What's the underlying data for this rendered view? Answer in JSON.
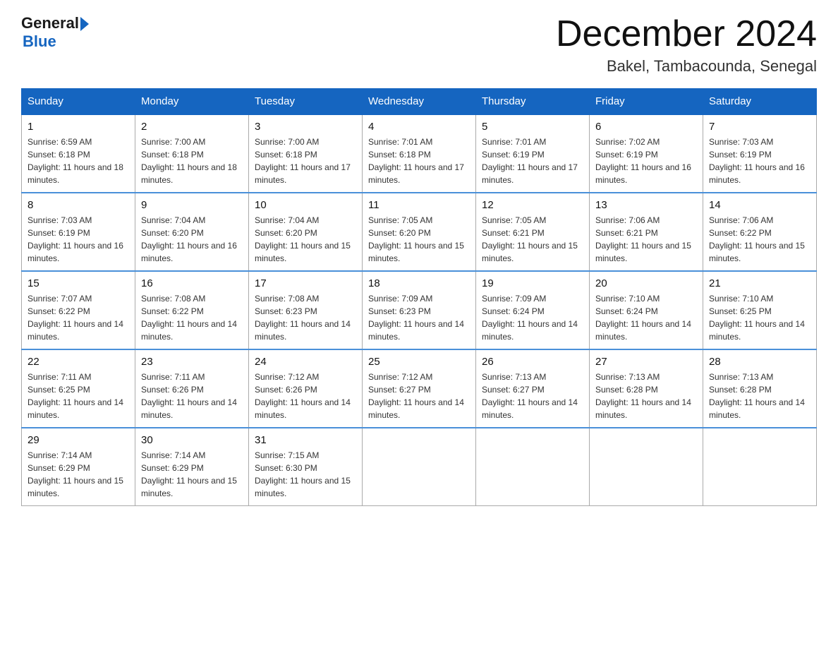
{
  "header": {
    "logo_general": "General",
    "logo_blue": "Blue",
    "title": "December 2024",
    "subtitle": "Bakel, Tambacounda, Senegal"
  },
  "days_of_week": [
    "Sunday",
    "Monday",
    "Tuesday",
    "Wednesday",
    "Thursday",
    "Friday",
    "Saturday"
  ],
  "weeks": [
    [
      {
        "day": "1",
        "sunrise": "Sunrise: 6:59 AM",
        "sunset": "Sunset: 6:18 PM",
        "daylight": "Daylight: 11 hours and 18 minutes."
      },
      {
        "day": "2",
        "sunrise": "Sunrise: 7:00 AM",
        "sunset": "Sunset: 6:18 PM",
        "daylight": "Daylight: 11 hours and 18 minutes."
      },
      {
        "day": "3",
        "sunrise": "Sunrise: 7:00 AM",
        "sunset": "Sunset: 6:18 PM",
        "daylight": "Daylight: 11 hours and 17 minutes."
      },
      {
        "day": "4",
        "sunrise": "Sunrise: 7:01 AM",
        "sunset": "Sunset: 6:18 PM",
        "daylight": "Daylight: 11 hours and 17 minutes."
      },
      {
        "day": "5",
        "sunrise": "Sunrise: 7:01 AM",
        "sunset": "Sunset: 6:19 PM",
        "daylight": "Daylight: 11 hours and 17 minutes."
      },
      {
        "day": "6",
        "sunrise": "Sunrise: 7:02 AM",
        "sunset": "Sunset: 6:19 PM",
        "daylight": "Daylight: 11 hours and 16 minutes."
      },
      {
        "day": "7",
        "sunrise": "Sunrise: 7:03 AM",
        "sunset": "Sunset: 6:19 PM",
        "daylight": "Daylight: 11 hours and 16 minutes."
      }
    ],
    [
      {
        "day": "8",
        "sunrise": "Sunrise: 7:03 AM",
        "sunset": "Sunset: 6:19 PM",
        "daylight": "Daylight: 11 hours and 16 minutes."
      },
      {
        "day": "9",
        "sunrise": "Sunrise: 7:04 AM",
        "sunset": "Sunset: 6:20 PM",
        "daylight": "Daylight: 11 hours and 16 minutes."
      },
      {
        "day": "10",
        "sunrise": "Sunrise: 7:04 AM",
        "sunset": "Sunset: 6:20 PM",
        "daylight": "Daylight: 11 hours and 15 minutes."
      },
      {
        "day": "11",
        "sunrise": "Sunrise: 7:05 AM",
        "sunset": "Sunset: 6:20 PM",
        "daylight": "Daylight: 11 hours and 15 minutes."
      },
      {
        "day": "12",
        "sunrise": "Sunrise: 7:05 AM",
        "sunset": "Sunset: 6:21 PM",
        "daylight": "Daylight: 11 hours and 15 minutes."
      },
      {
        "day": "13",
        "sunrise": "Sunrise: 7:06 AM",
        "sunset": "Sunset: 6:21 PM",
        "daylight": "Daylight: 11 hours and 15 minutes."
      },
      {
        "day": "14",
        "sunrise": "Sunrise: 7:06 AM",
        "sunset": "Sunset: 6:22 PM",
        "daylight": "Daylight: 11 hours and 15 minutes."
      }
    ],
    [
      {
        "day": "15",
        "sunrise": "Sunrise: 7:07 AM",
        "sunset": "Sunset: 6:22 PM",
        "daylight": "Daylight: 11 hours and 14 minutes."
      },
      {
        "day": "16",
        "sunrise": "Sunrise: 7:08 AM",
        "sunset": "Sunset: 6:22 PM",
        "daylight": "Daylight: 11 hours and 14 minutes."
      },
      {
        "day": "17",
        "sunrise": "Sunrise: 7:08 AM",
        "sunset": "Sunset: 6:23 PM",
        "daylight": "Daylight: 11 hours and 14 minutes."
      },
      {
        "day": "18",
        "sunrise": "Sunrise: 7:09 AM",
        "sunset": "Sunset: 6:23 PM",
        "daylight": "Daylight: 11 hours and 14 minutes."
      },
      {
        "day": "19",
        "sunrise": "Sunrise: 7:09 AM",
        "sunset": "Sunset: 6:24 PM",
        "daylight": "Daylight: 11 hours and 14 minutes."
      },
      {
        "day": "20",
        "sunrise": "Sunrise: 7:10 AM",
        "sunset": "Sunset: 6:24 PM",
        "daylight": "Daylight: 11 hours and 14 minutes."
      },
      {
        "day": "21",
        "sunrise": "Sunrise: 7:10 AM",
        "sunset": "Sunset: 6:25 PM",
        "daylight": "Daylight: 11 hours and 14 minutes."
      }
    ],
    [
      {
        "day": "22",
        "sunrise": "Sunrise: 7:11 AM",
        "sunset": "Sunset: 6:25 PM",
        "daylight": "Daylight: 11 hours and 14 minutes."
      },
      {
        "day": "23",
        "sunrise": "Sunrise: 7:11 AM",
        "sunset": "Sunset: 6:26 PM",
        "daylight": "Daylight: 11 hours and 14 minutes."
      },
      {
        "day": "24",
        "sunrise": "Sunrise: 7:12 AM",
        "sunset": "Sunset: 6:26 PM",
        "daylight": "Daylight: 11 hours and 14 minutes."
      },
      {
        "day": "25",
        "sunrise": "Sunrise: 7:12 AM",
        "sunset": "Sunset: 6:27 PM",
        "daylight": "Daylight: 11 hours and 14 minutes."
      },
      {
        "day": "26",
        "sunrise": "Sunrise: 7:13 AM",
        "sunset": "Sunset: 6:27 PM",
        "daylight": "Daylight: 11 hours and 14 minutes."
      },
      {
        "day": "27",
        "sunrise": "Sunrise: 7:13 AM",
        "sunset": "Sunset: 6:28 PM",
        "daylight": "Daylight: 11 hours and 14 minutes."
      },
      {
        "day": "28",
        "sunrise": "Sunrise: 7:13 AM",
        "sunset": "Sunset: 6:28 PM",
        "daylight": "Daylight: 11 hours and 14 minutes."
      }
    ],
    [
      {
        "day": "29",
        "sunrise": "Sunrise: 7:14 AM",
        "sunset": "Sunset: 6:29 PM",
        "daylight": "Daylight: 11 hours and 15 minutes."
      },
      {
        "day": "30",
        "sunrise": "Sunrise: 7:14 AM",
        "sunset": "Sunset: 6:29 PM",
        "daylight": "Daylight: 11 hours and 15 minutes."
      },
      {
        "day": "31",
        "sunrise": "Sunrise: 7:15 AM",
        "sunset": "Sunset: 6:30 PM",
        "daylight": "Daylight: 11 hours and 15 minutes."
      },
      null,
      null,
      null,
      null
    ]
  ]
}
